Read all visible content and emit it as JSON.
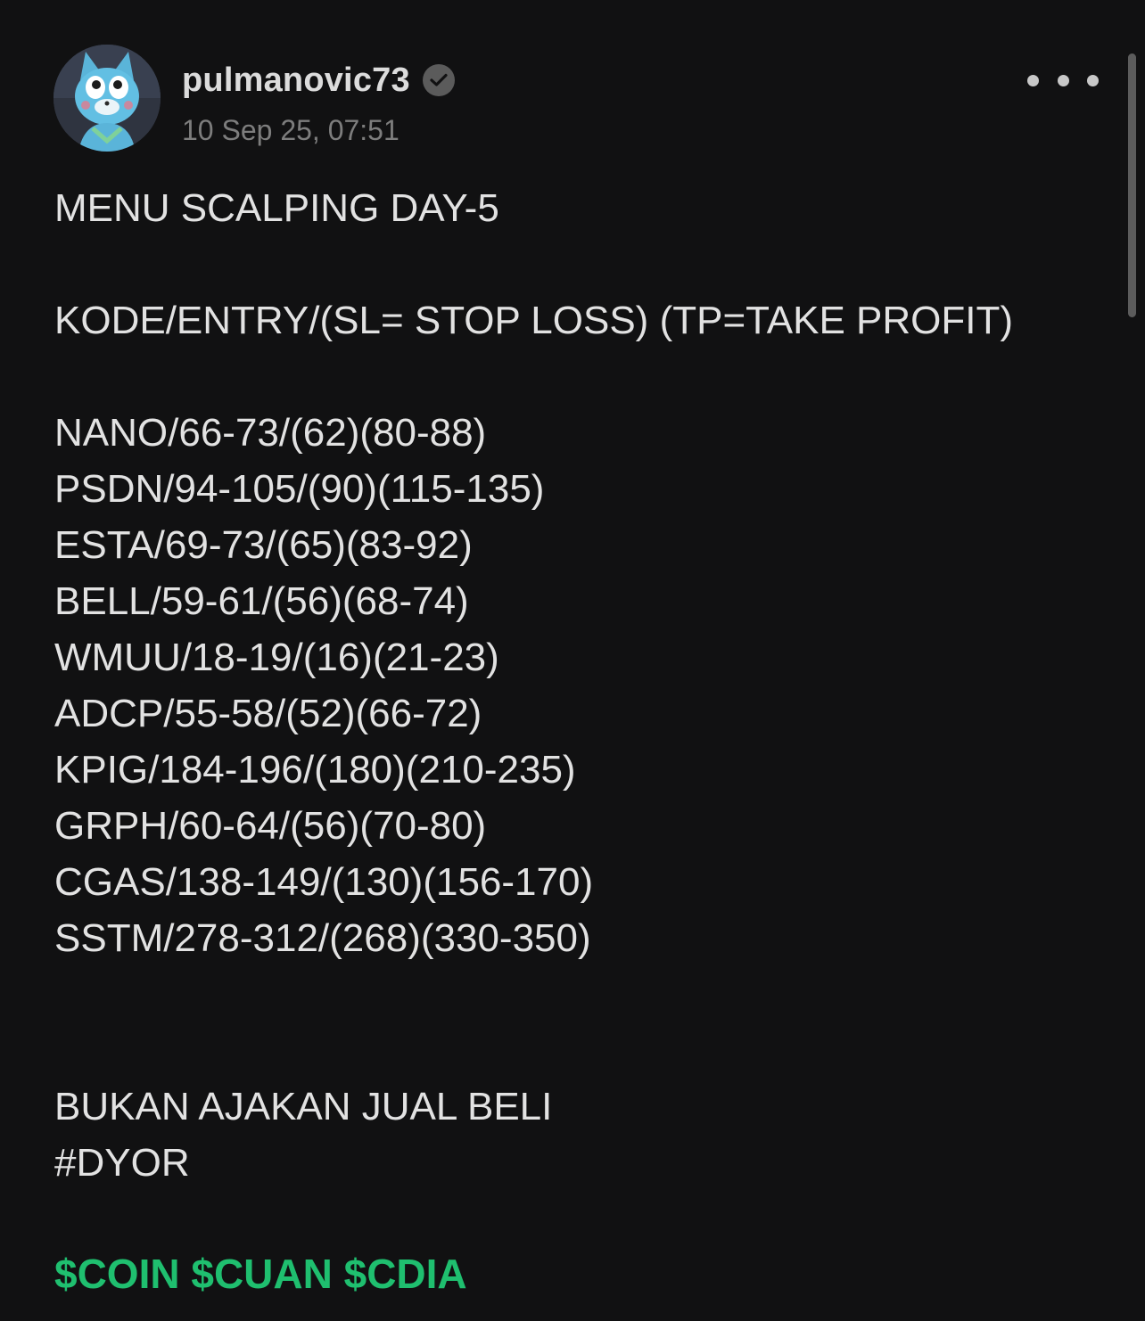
{
  "post": {
    "author": {
      "username": "pulmanovic73",
      "verified": true
    },
    "timestamp": "10 Sep 25, 07:51",
    "title": "MENU SCALPING DAY-5",
    "legend": "KODE/ENTRY/(SL= STOP LOSS) (TP=TAKE PROFIT)",
    "picks": [
      "NANO/66-73/(62)(80-88)",
      "PSDN/94-105/(90)(115-135)",
      "ESTA/69-73/(65)(83-92)",
      "BELL/59-61/(56)(68-74)",
      "WMUU/18-19/(16)(21-23)",
      "ADCP/55-58/(52)(66-72)",
      "KPIG/184-196/(180)(210-235)",
      "GRPH/60-64/(56)(70-80)",
      "CGAS/138-149/(130)(156-170)",
      "SSTM/278-312/(268)(330-350)"
    ],
    "disclaimer": "BUKAN AJAKAN JUAL BELI",
    "hashtag": "#DYOR",
    "tickers": [
      "$COIN",
      "$CUAN",
      "$CDIA"
    ]
  },
  "icons": {
    "verified": "verified-check-icon",
    "more": "more-options-icon"
  },
  "colors": {
    "background": "#111112",
    "text": "#e2e2e2",
    "muted": "#7d7d7d",
    "ticker": "#1fbf6f"
  }
}
